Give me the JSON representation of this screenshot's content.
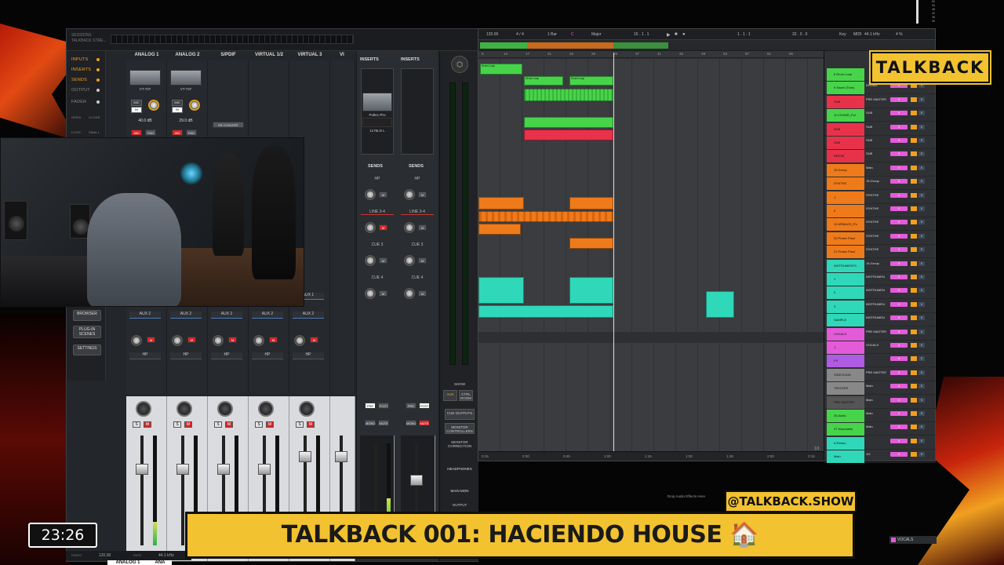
{
  "overlay": {
    "logo": "TALKBACK",
    "handle": "@TALKBACK.SHOW",
    "title": "TALKBACK 001: HACIENDO HOUSE 🏠",
    "clock": "23:26"
  },
  "console": {
    "app_title": "SESSIONS TALKBACK STRE...",
    "sidebar": [
      {
        "label": "INPUTS",
        "color": "#f0a020"
      },
      {
        "label": "INSERTS",
        "color": "#f0a020"
      },
      {
        "label": "SENDS",
        "color": "#f0a020"
      },
      {
        "label": "OUTPUT",
        "color": "#777777"
      },
      {
        "label": "FADER",
        "color": "#777777"
      }
    ],
    "side_small": [
      "OPEN",
      "CLOSE",
      "LOGS",
      "SMALL"
    ],
    "side_buttons": [
      "BROWSER",
      "PLUG-IN SCENES",
      "SETTINGS"
    ],
    "channels": [
      "ANALOG 1",
      "ANALOG 2",
      "S/PDIF",
      "VIRTUAL 1/2",
      "VIRTUAL 3",
      "VI"
    ],
    "ch1": {
      "plugin": "VT-737",
      "mic": "MIC",
      "in": "IN",
      "gain": "40.0 dB",
      "phantom": "48V",
      "pad": "PAD"
    },
    "ch2": {
      "plugin": "VT-737",
      "mic": "MIC",
      "in": "IN",
      "gain": "29.0 dB",
      "phantom": "48V",
      "pad": "PAD"
    },
    "src_convert": "SR CONVERT",
    "aux2": "AUX 2",
    "aux1": "AUX 1",
    "hp": "HP",
    "solo": "S",
    "mute": "M",
    "strip_bottom": [
      "ANALOG 1",
      "ANA"
    ],
    "mid": {
      "inserts_a": "INSERTS",
      "inserts_b": "INSERTS",
      "plugin_a": "Pultec-Pro",
      "plugin_b": "1176LN L",
      "sends_a": "SENDS",
      "sends_b": "SENDS",
      "hp": "HP",
      "line": "LINE 3-4",
      "cue3": "CUE 3",
      "cue4": "CUE 4",
      "pre": "PRE",
      "post": "POST",
      "mono": "MONO",
      "mute": "MUTE"
    },
    "monitor": {
      "show": "SHOW",
      "aux": "AUX",
      "ctrl": "CTRL ROOM",
      "cue_outputs": "CUE OUTPUTS",
      "monitor_controllers": "MONITOR CONTROLLERS",
      "monitor_correction": "MONITOR CORRECTION",
      "headphones": "HEADPHONES",
      "main_mon": "MAIN MON",
      "output": "OUTPUT",
      "mono": "MONO",
      "mute": "MUTE"
    },
    "status": {
      "tempo_label": "TEMPO",
      "tempo": "120.00",
      "rate_label": "RATE",
      "rate": "44.1 kHz"
    }
  },
  "daw": {
    "transport": {
      "tempo": "120.00",
      "sig": "4 / 4",
      "bar": "1 Bar",
      "key": "C",
      "scale": "Major",
      "pos": "15 . 1 . 1",
      "pos2": "1 . 1 . 1",
      "zoom": "32 . 0 . 0",
      "key_lbl": "Key",
      "midi": "MIDI",
      "rate": "44.1 kHz",
      "cpu": "4 %"
    },
    "ruler": [
      "9",
      "13",
      "17",
      "21",
      "25",
      "29",
      "33",
      "37",
      "41",
      "45",
      "49",
      "53",
      "57",
      "61",
      "65"
    ],
    "timeline": [
      "0:15",
      "0:30",
      "0:45",
      "1:00",
      "1:15",
      "1:30",
      "1:45",
      "2:00",
      "2:15"
    ],
    "page": "1/1",
    "drop_text": "Drop Audio Effects Here",
    "clip_labels": [
      "Drum Loop",
      "Drum Loop",
      "Drum Loop"
    ],
    "tracks": [
      {
        "name": "8 Drum Loop",
        "io": "",
        "vol": "0",
        "color": "#47d44a"
      },
      {
        "name": "9 Snare (Tone)",
        "io": "DRUMS",
        "vol": "0",
        "color": "#47d44a"
      },
      {
        "name": "SUB",
        "io": "PRE MASTER",
        "vol": "0",
        "color": "#e8324a"
      },
      {
        "name": "11 KSHMR_Pul",
        "io": "SUB",
        "vol": "0",
        "color": "#47d44a"
      },
      {
        "name": "SUB",
        "io": "SUB",
        "vol": "0",
        "color": "#e8324a"
      },
      {
        "name": "SUB",
        "io": "SUB",
        "vol": "0",
        "color": "#e8324a"
      },
      {
        "name": "REESE",
        "io": "SUB",
        "vol": "0",
        "color": "#e8324a"
      },
      {
        "name": "15 Group",
        "io": "Main",
        "vol": "0",
        "color": "#ef7a1a"
      },
      {
        "name": "SYNTHS",
        "io": "15-Group",
        "vol": "0",
        "color": "#ef7a1a"
      },
      {
        "name": "1",
        "io": "SYNTHS",
        "vol": "0",
        "color": "#ef7a1a"
      },
      {
        "name": "2",
        "io": "SYNTHS",
        "vol": "0",
        "color": "#ef7a1a"
      },
      {
        "name": "19 ARMAGS_Po",
        "io": "SYNTHS",
        "vol": "0",
        "color": "#ef7a1a"
      },
      {
        "name": "20 Phase Plant",
        "io": "SYNTHS",
        "vol": "0",
        "color": "#ef7a1a"
      },
      {
        "name": "21 Phase Plant",
        "io": "SYNTHS",
        "vol": "0",
        "color": "#ef7a1a"
      },
      {
        "name": "INSTRUMENTS",
        "io": "15-Group",
        "vol": "0",
        "color": "#2fd8b8"
      },
      {
        "name": "1",
        "io": "INSTRUMEN",
        "vol": "0",
        "color": "#2fd8b8"
      },
      {
        "name": "2",
        "io": "INSTRUMEN",
        "vol": "0",
        "color": "#2fd8b8"
      },
      {
        "name": "3",
        "io": "INSTRUMEN",
        "vol": "0",
        "color": "#2fd8b8"
      },
      {
        "name": "SAMPLE",
        "io": "INSTRUMEN",
        "vol": "0",
        "color": "#2fd8b8"
      },
      {
        "name": "VOCALS",
        "io": "PRE MASTER",
        "vol": "0",
        "color": "#e35bd8"
      },
      {
        "name": "1",
        "io": "VOCALS",
        "vol": "0",
        "color": "#e35bd8"
      },
      {
        "name": "FX",
        "io": "",
        "vol": "0",
        "color": "#b05be3"
      },
      {
        "name": "SIDECHAIN",
        "io": "PRE MASTER",
        "vol": "0",
        "color": "#888888"
      },
      {
        "name": "TRIGGER",
        "io": "Main",
        "vol": "0",
        "color": "#888888"
      },
      {
        "name": "PRE MASTER",
        "io": "Main",
        "vol": "0",
        "color": "#555555"
      },
      {
        "name": "36 Audio",
        "io": "Main",
        "vol": "0",
        "color": "#47d44a"
      },
      {
        "name": "37 Wavetable",
        "io": "Main",
        "vol": "0",
        "color": "#47d44a"
      },
      {
        "name": "A Return",
        "io": "",
        "vol": "0",
        "color": "#2fd8b8"
      },
      {
        "name": "Main",
        "io": "1/2",
        "vol": "0",
        "color": "#2fd8b8"
      }
    ],
    "vocals_chip": "VOCALS"
  },
  "colors": {
    "accent": "#f2c230",
    "drums": "#47d44a",
    "sub": "#e8324a",
    "synths": "#ef7a1a",
    "instruments": "#2fd8b8",
    "vocals": "#e35bd8"
  }
}
